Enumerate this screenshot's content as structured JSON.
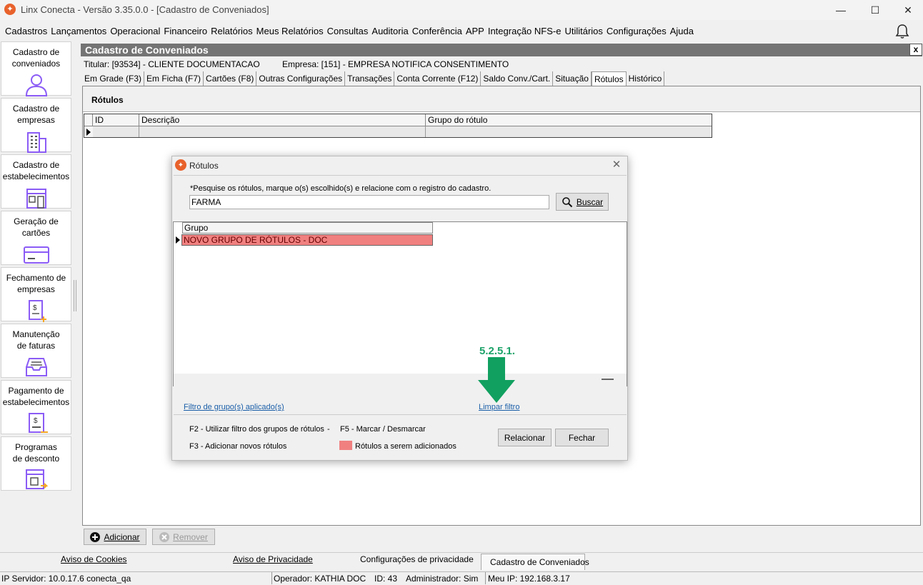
{
  "window": {
    "title": "Linx Conecta - Versão 3.35.0.0 - [Cadastro de Conveniados]",
    "minimize": "—",
    "maximize": "☐",
    "close": "✕"
  },
  "menu": [
    "Cadastros",
    "Lançamentos",
    "Operacional",
    "Financeiro",
    "Relatórios",
    "Meus Relatórios",
    "Consultas",
    "Auditoria",
    "Conferência",
    "APP",
    "Integração NFS-e",
    "Utilitários",
    "Configurações",
    "Ajuda"
  ],
  "sidebar": {
    "items": [
      {
        "label1": "Cadastro de",
        "label2": "conveniados",
        "icon": "person-icon"
      },
      {
        "label1": "Cadastro de",
        "label2": "empresas",
        "icon": "building-icon"
      },
      {
        "label1": "Cadastro de",
        "label2": "estabelecimentos",
        "icon": "store-icon"
      },
      {
        "label1": "Geração de",
        "label2": "cartões",
        "icon": "card-icon"
      },
      {
        "label1": "Fechamento de",
        "label2": "empresas",
        "icon": "invoice-icon"
      },
      {
        "label1": "Manutenção",
        "label2": "de faturas",
        "icon": "inbox-icon"
      },
      {
        "label1": "Pagamento de",
        "label2": "estabelecimentos",
        "icon": "payment-icon"
      },
      {
        "label1": "Programas",
        "label2": "de desconto",
        "icon": "discount-icon"
      }
    ],
    "accent": "#8b5cf6"
  },
  "form": {
    "title": "Cadastro de Conveniados",
    "close": "x",
    "titular": "Titular: [93534] - CLIENTE DOCUMENTACAO",
    "empresa": "Empresa: [151] - EMPRESA NOTIFICA CONSENTIMENTO",
    "tabs": [
      "Em Grade (F3)",
      "Em Ficha (F7)",
      "Cartões (F8)",
      "Outras Configurações",
      "Transações",
      "Conta Corrente (F12)",
      "Saldo Conv./Cart.",
      "Situação",
      "Rótulos",
      "Histórico"
    ],
    "active_tab": "Rótulos",
    "section_title": "Rótulos",
    "grid_columns": [
      "ID",
      "Descrição",
      "Grupo do rótulo"
    ],
    "add_button": "Adicionar",
    "remove_button": "Remover"
  },
  "dialog": {
    "title": "Rótulos",
    "hint": "*Pesquise os rótulos, marque o(s) escolhido(s) e relacione com o registro do cadastro.",
    "search_value": "FARMA",
    "search_button": "Buscar",
    "grid_header": "Grupo",
    "grid_rows": [
      "NOVO GRUPO DE RÓTULOS - DOC"
    ],
    "filter_link": "Filtro de grupo(s) aplicado(s)",
    "clear_filter_link": "Limpar filtro",
    "help_f2": "F2 - Utilizar filtro dos grupos de rótulos",
    "help_sep": "-",
    "help_f5": "F5 - Marcar / Desmarcar",
    "help_f3": "F3 - Adicionar novos rótulos",
    "legend": "Rótulos a serem adicionados",
    "legend_color": "#f08080",
    "relate_button": "Relacionar",
    "close_button": "Fechar",
    "step_annotation": "5.2.5.1."
  },
  "status_tabs": [
    "Aviso de Cookies",
    "Aviso de Privacidade",
    "Configurações de privacidade",
    "Cadastro de Conveniados"
  ],
  "status": {
    "server": "IP Servidor: 10.0.17.6 conecta_qa",
    "operator": "Operador: KATHIA DOC",
    "id": "ID: 43",
    "admin": "Administrador: Sim",
    "my_ip": "Meu IP: 192.168.3.17"
  }
}
